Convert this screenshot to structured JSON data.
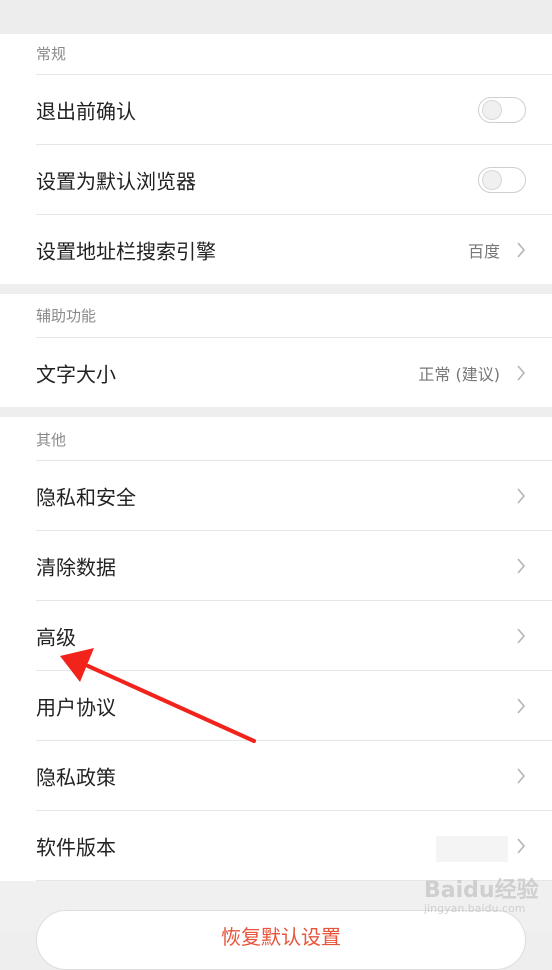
{
  "sections": {
    "general": {
      "header": "常规",
      "rows": {
        "confirm_exit": "退出前确认",
        "default_browser": "设置为默认浏览器",
        "search_engine": "设置地址栏搜索引擎",
        "search_engine_value": "百度"
      }
    },
    "accessibility": {
      "header": "辅助功能",
      "rows": {
        "text_size": "文字大小",
        "text_size_value": "正常 (建议)"
      }
    },
    "other": {
      "header": "其他",
      "rows": {
        "privacy_security": "隐私和安全",
        "clear_data": "清除数据",
        "advanced": "高级",
        "user_agreement": "用户协议",
        "privacy_policy": "隐私政策",
        "software_version": "软件版本"
      }
    }
  },
  "bottom": {
    "reset_label": "恢复默认设置"
  },
  "toggles": {
    "confirm_exit": false,
    "default_browser": false
  },
  "watermark": {
    "main": "Baidu经验",
    "sub": "jingyan.baidu.com"
  },
  "colors": {
    "accent_red": "#e8533a",
    "annotation_arrow": "#f2231b"
  },
  "icons": {
    "chevron": "chevron-right-icon"
  }
}
